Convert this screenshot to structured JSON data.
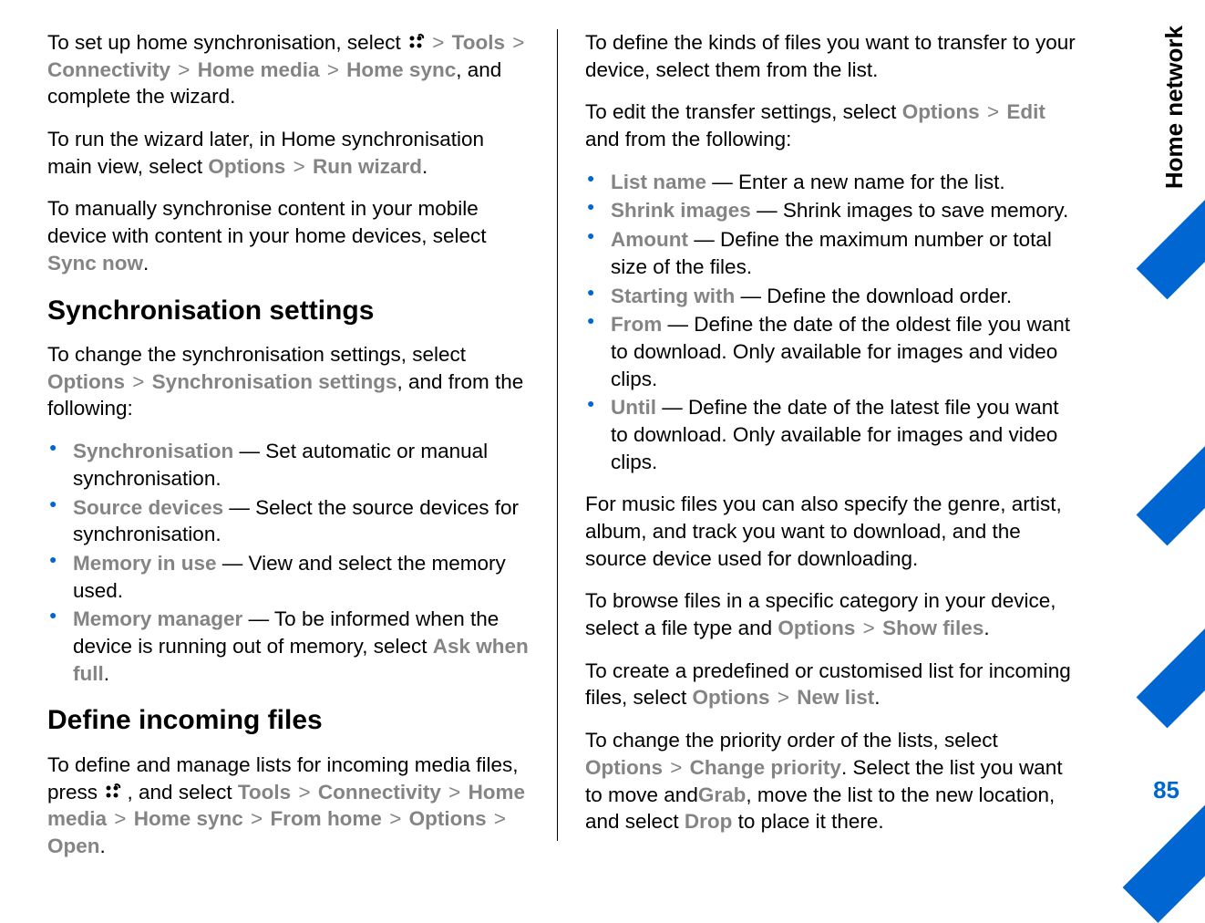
{
  "sidebar": {
    "section": "Home network",
    "page": "85"
  },
  "left": {
    "p1": {
      "t1": "To set up home synchronisation, select ",
      "tools": "Tools",
      "connectivity": "Connectivity",
      "home_media": "Home media",
      "home_sync": "Home sync",
      "t2": ", and complete the wizard."
    },
    "p2": {
      "t1": "To run the wizard later, in Home synchronisation main view, select ",
      "options": "Options",
      "run_wizard": "Run wizard",
      "t2": "."
    },
    "p3": {
      "t1": "To manually synchronise content in your mobile device with content in your home devices, select ",
      "sync_now": "Sync now",
      "t2": "."
    },
    "h1": "Synchronisation settings",
    "p4": {
      "t1": "To change the synchronisation settings, select ",
      "options": "Options",
      "sync_settings": "Synchronisation settings",
      "t2": ", and from the following:"
    },
    "list1": [
      {
        "term": "Synchronisation",
        "desc": " — Set automatic or manual synchronisation."
      },
      {
        "term": "Source devices",
        "desc": " — Select the source devices for synchronisation."
      },
      {
        "term": "Memory in use",
        "desc": " — View and select the memory used."
      },
      {
        "term": "Memory manager",
        "desc_pre": " — To be informed when the device is running out of memory, select ",
        "em": "Ask when full",
        "desc_post": "."
      }
    ],
    "h2": "Define incoming files",
    "p5": {
      "t1": "To define and manage lists for incoming media files, press ",
      "t2": " , and select ",
      "tools": "Tools",
      "connectivity": "Connectivity",
      "home_media": "Home media",
      "home_sync": "Home sync",
      "from_home": "From home",
      "options": "Options",
      "open": "Open",
      "t3": "."
    }
  },
  "right": {
    "p1": "To define the kinds of files you want to transfer to your device, select them from the list.",
    "p2": {
      "t1": "To edit the transfer settings, select ",
      "options": "Options",
      "edit": "Edit",
      "t2": " and from the following:"
    },
    "list1": [
      {
        "term": "List name",
        "desc": " — Enter a new name for the list."
      },
      {
        "term": "Shrink images",
        "desc": " — Shrink images to save memory."
      },
      {
        "term": "Amount",
        "desc": " — Define the maximum number or total size of the files."
      },
      {
        "term": "Starting with",
        "desc": " — Define the download order."
      },
      {
        "term": "From",
        "desc": " — Define the date of the oldest file you want to download. Only available for images and video clips."
      },
      {
        "term": "Until",
        "desc": " — Define the date of the latest file you want to download. Only available for images and video clips."
      }
    ],
    "p3": "For music files you can also specify the genre, artist, album, and track you want to download, and the source device used for downloading.",
    "p4": {
      "t1": "To browse files in a specific category in your device, select a file type and ",
      "options": "Options",
      "show_files": "Show files",
      "t2": "."
    },
    "p5": {
      "t1": "To create a predefined or customised list for incoming files, select ",
      "options": "Options",
      "new_list": "New list",
      "t2": "."
    },
    "p6": {
      "t1": "To change the priority order of the lists, select ",
      "options": "Options",
      "change_priority": "Change priority",
      "t2": ". Select the list you want to move and",
      "grab": "Grab",
      "t3": ", move the list to the new location, and select ",
      "drop": "Drop",
      "t4": " to place it there."
    }
  }
}
